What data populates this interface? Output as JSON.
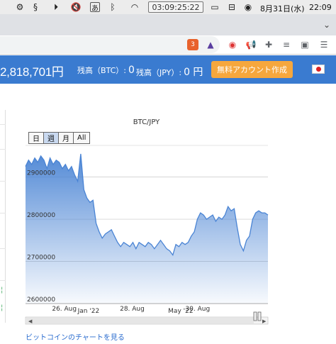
{
  "menubar": {
    "time_display": "03:09:25:22",
    "date": "8月31日(水)",
    "clock": "22:09",
    "input_method": "あ"
  },
  "header": {
    "price": "2,818,701円",
    "btc_label": "残高（BTC）:",
    "btc_value": "0",
    "jpy_label": "残高（JPY）:",
    "jpy_value": "0 円",
    "cta_label": "無料アカウント作成",
    "brave_badge": "3"
  },
  "chart": {
    "range_buttons": [
      "日",
      "週",
      "月",
      "All"
    ],
    "active_range": "週",
    "link_text": "ビットコインのチャートを見る"
  },
  "colors": {
    "header_bg": "#3a7bd0",
    "cta_bg": "#f6a73d",
    "series_line": "#4a84d4",
    "link": "#2a6ccf"
  },
  "chart_data": {
    "type": "area",
    "title": "BTC/JPY",
    "xlabel": "",
    "ylabel": "",
    "ylim": [
      2600000,
      2975000
    ],
    "y_ticks": [
      "2600000",
      "2700000",
      "2800000",
      "2900000"
    ],
    "x_tick_labels": [
      "26. Aug",
      "28. Aug",
      "30. Aug"
    ],
    "navigator_labels": [
      "Jan '22",
      "May '22"
    ],
    "grid": true,
    "series": [
      {
        "values": [
          2925000,
          2940000,
          2930000,
          2945000,
          2935000,
          2950000,
          2940000,
          2920000,
          2945000,
          2930000,
          2940000,
          2935000,
          2920000,
          2930000,
          2915000,
          2925000,
          2905000,
          2890000,
          2955000,
          2870000,
          2850000,
          2840000,
          2845000,
          2790000,
          2770000,
          2755000,
          2765000,
          2770000,
          2775000,
          2760000,
          2745000,
          2735000,
          2745000,
          2740000,
          2735000,
          2745000,
          2730000,
          2745000,
          2740000,
          2735000,
          2745000,
          2740000,
          2730000,
          2740000,
          2750000,
          2740000,
          2730000,
          2725000,
          2715000,
          2740000,
          2735000,
          2745000,
          2740000,
          2745000,
          2760000,
          2770000,
          2800000,
          2815000,
          2810000,
          2800000,
          2805000,
          2810000,
          2795000,
          2805000,
          2800000,
          2810000,
          2830000,
          2820000,
          2825000,
          2780000,
          2740000,
          2725000,
          2750000,
          2760000,
          2800000,
          2815000,
          2820000,
          2815000,
          2815000,
          2810000
        ]
      }
    ]
  }
}
